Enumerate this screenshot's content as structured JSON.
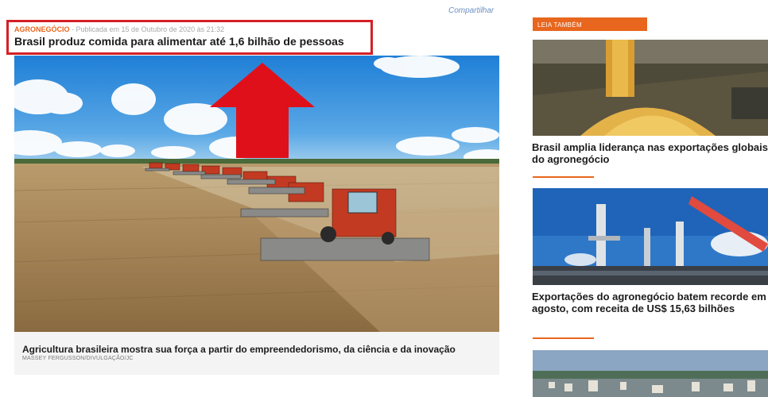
{
  "header": {
    "share_label": "Compartilhar"
  },
  "article": {
    "category": "AGRONEGÓCIO",
    "separator": " - ",
    "published": "Publicada em 15 de Outubro de 2020 às 21:32",
    "headline": "Brasil produz comida para alimentar até 1,6 bilhão de pessoas",
    "image_subject": "combine-harvesters-in-wheat-field",
    "caption": "Agricultura brasileira mostra sua força a partir do empreendedorismo, da ciência e da inovação",
    "credit": "MASSEY FERGUSSON/DIVULGAÇÃO/JC"
  },
  "annotation": {
    "highlight_color": "#d42026",
    "arrow_direction": "up"
  },
  "sidebar": {
    "section_label": "LEIA TAMBÉM",
    "accent": "#e8661d",
    "items": [
      {
        "title": "Brasil amplia liderança nas exportações globais do agronegócio",
        "image": "corn-grain-pouring"
      },
      {
        "title": "Exportações do agronegócio batem recorde em agosto, com receita de US$ 15,63 bilhões",
        "image": "port-cranes-ship"
      },
      {
        "image": "aerial-city-view"
      }
    ]
  }
}
